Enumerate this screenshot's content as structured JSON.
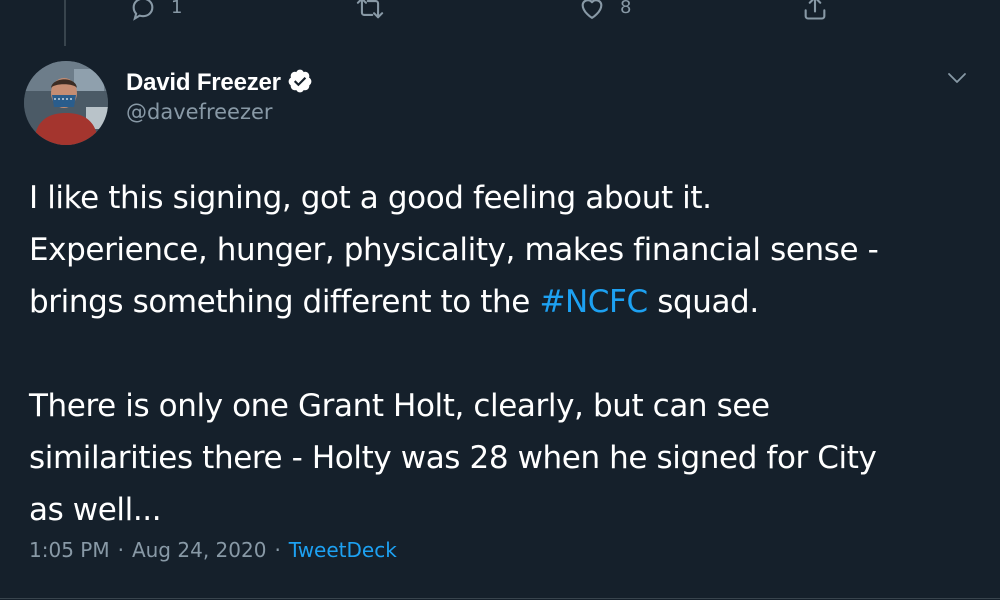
{
  "previous_tweet": {
    "reply_count": "1",
    "retweet_count": "",
    "like_count": "8"
  },
  "author": {
    "display_name": "David Freezer",
    "handle": "@davefreezer",
    "verified": true
  },
  "tweet": {
    "line1": "I like this signing, got a good feeling about it.",
    "line2": "Experience, hunger, physicality, makes financial sense -",
    "line3_before": "brings something different to the ",
    "hashtag": "#NCFC",
    "line3_after": " squad.",
    "line4": "There is only one Grant Holt, clearly, but can see",
    "line5": "similarities there - Holty was 28 when he signed for City",
    "line6": "as well..."
  },
  "meta": {
    "time": "1:05 PM",
    "sep1": "·",
    "date": "Aug 24, 2020",
    "sep2": "·",
    "source": "TweetDeck"
  },
  "colors": {
    "background": "#15202b",
    "accent": "#1da1f2",
    "secondary_text": "#8899a6",
    "border": "#38444d"
  },
  "icons": {
    "reply": "reply-icon",
    "retweet": "retweet-icon",
    "like": "heart-icon",
    "share": "share-icon",
    "caret": "chevron-down-icon",
    "verified": "verified-badge-icon"
  }
}
